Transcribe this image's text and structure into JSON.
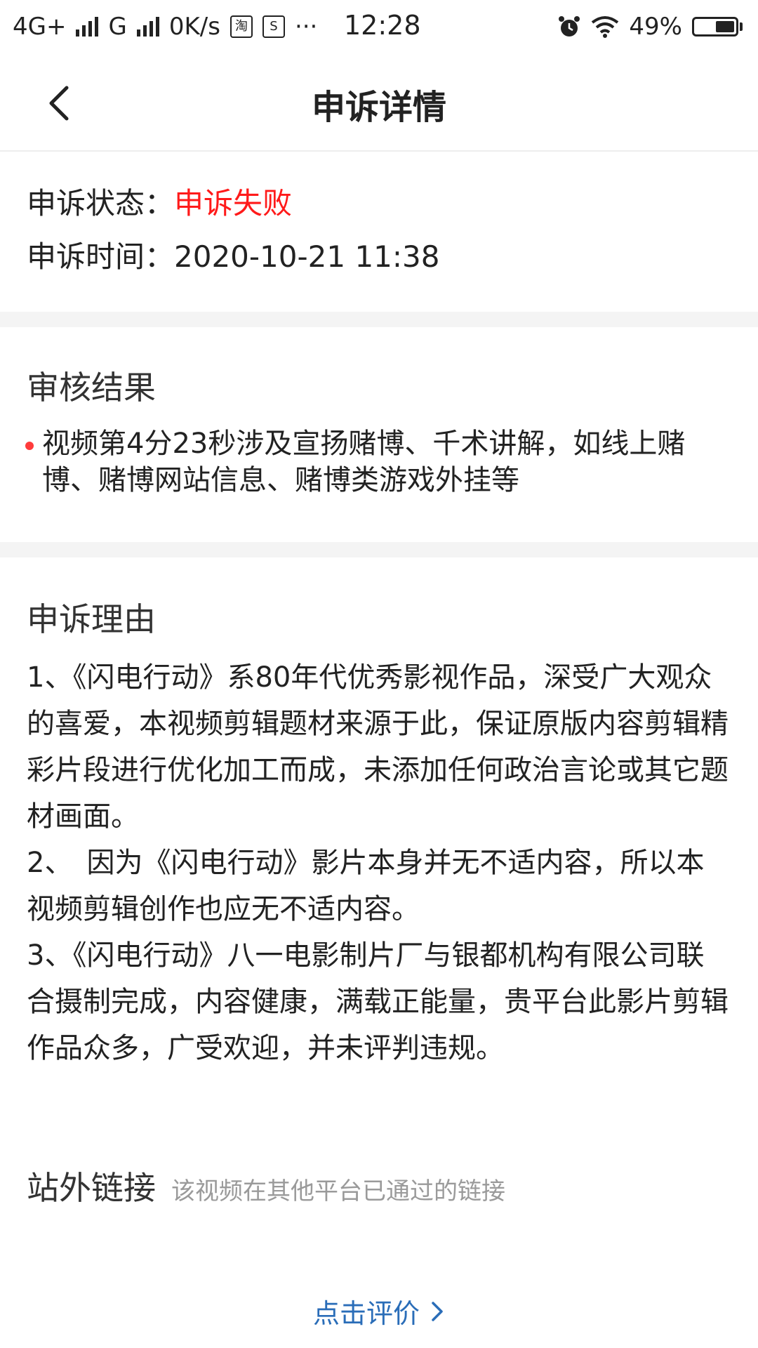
{
  "status_bar": {
    "network1": "4G+",
    "network2": "G",
    "speed": "0K/s",
    "app_badge_1": "淘",
    "app_badge_2": "S",
    "more": "···",
    "time": "12:28",
    "battery_percent": "49%",
    "battery_level": 0.49,
    "icons": [
      "signal-icon",
      "taobao-icon",
      "app-s-icon",
      "more-icon",
      "alarm-icon",
      "wifi-icon",
      "battery-icon"
    ]
  },
  "header": {
    "title": "申诉详情",
    "back_icon": "chevron-left-icon"
  },
  "status_section": {
    "status_label": "申诉状态：",
    "status_value": "申诉失败",
    "status_color": "#ff1a1a",
    "time_label": "申诉时间：",
    "time_value": "2020-10-21 11:38"
  },
  "review_section": {
    "title": "审核结果",
    "items": [
      "视频第4分23秒涉及宣扬赌博、千术讲解，如线上赌博、赌博网站信息、赌博类游戏外挂等"
    ]
  },
  "reason_section": {
    "title": "申诉理由",
    "paragraphs": [
      "1、《闪电行动》系80年代优秀影视作品，深受广大观众的喜爱，本视频剪辑题材来源于此，保证原版内容剪辑精彩片段进行优化加工而成，未添加任何政治言论或其它题材画面。",
      "2、　因为《闪电行动》影片本身并无不适内容，所以本视频剪辑创作也应无不适内容。",
      "3、《闪电行动》八一电影制片厂与银都机构有限公司联合摄制完成，内容健康，满载正能量，贵平台此影片剪辑作品众多，广受欢迎，并未评判违规。"
    ]
  },
  "external_links": {
    "title": "站外链接",
    "hint": "该视频在其他平台已通过的链接"
  },
  "footer": {
    "rate_label": "点击评价",
    "rate_color": "#2a6db8"
  }
}
